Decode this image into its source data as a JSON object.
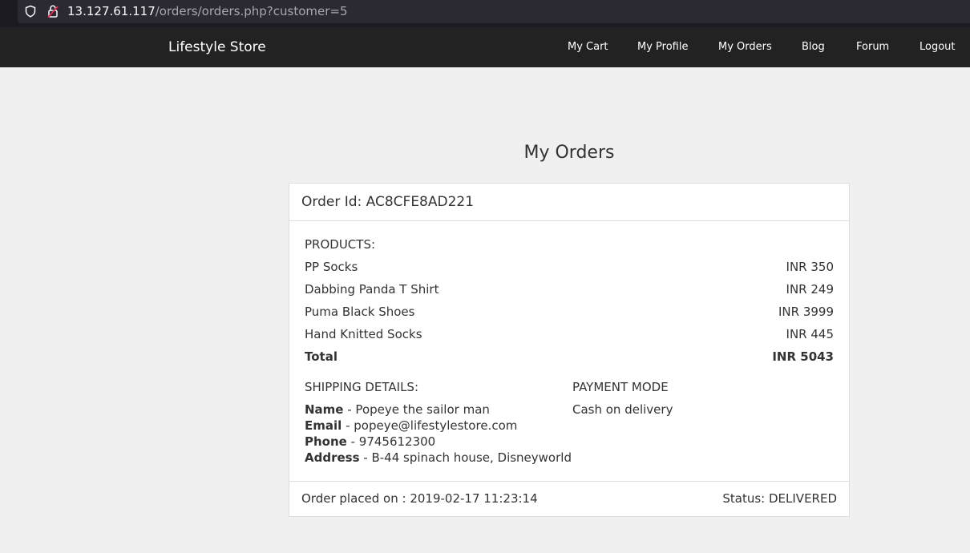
{
  "browser": {
    "url_host": "13.127.61.117",
    "url_path": "/orders/orders.php?customer=5",
    "icons": [
      "shield-icon",
      "lock-icon"
    ]
  },
  "navbar": {
    "brand": "Lifestyle Store",
    "links": [
      "My Cart",
      "My Profile",
      "My Orders",
      "Blog",
      "Forum",
      "Logout"
    ]
  },
  "page": {
    "title": "My Orders"
  },
  "order": {
    "id_label": "Order Id: AC8CFE8AD221",
    "products_title": "PRODUCTS:",
    "products": [
      {
        "name": "PP Socks",
        "price": "INR 350"
      },
      {
        "name": "Dabbing Panda T Shirt",
        "price": "INR 249"
      },
      {
        "name": "Puma Black Shoes",
        "price": "INR 3999"
      },
      {
        "name": "Hand Knitted Socks",
        "price": "INR 445"
      }
    ],
    "total_label": "Total",
    "total_value": "INR 5043",
    "shipping_title": "SHIPPING DETAILS:",
    "shipping": {
      "name_label": "Name",
      "name_value": " - Popeye the sailor man",
      "email_label": "Email",
      "email_value": " - popeye@lifestylestore.com",
      "phone_label": "Phone",
      "phone_value": " - 9745612300",
      "address_label": "Address",
      "address_value": " - B-44 spinach house, Disneyworld"
    },
    "payment_title": "PAYMENT MODE",
    "payment_value": "Cash on delivery",
    "placed_on": "Order placed on : 2019-02-17 11:23:14",
    "status": "Status: DELIVERED"
  }
}
